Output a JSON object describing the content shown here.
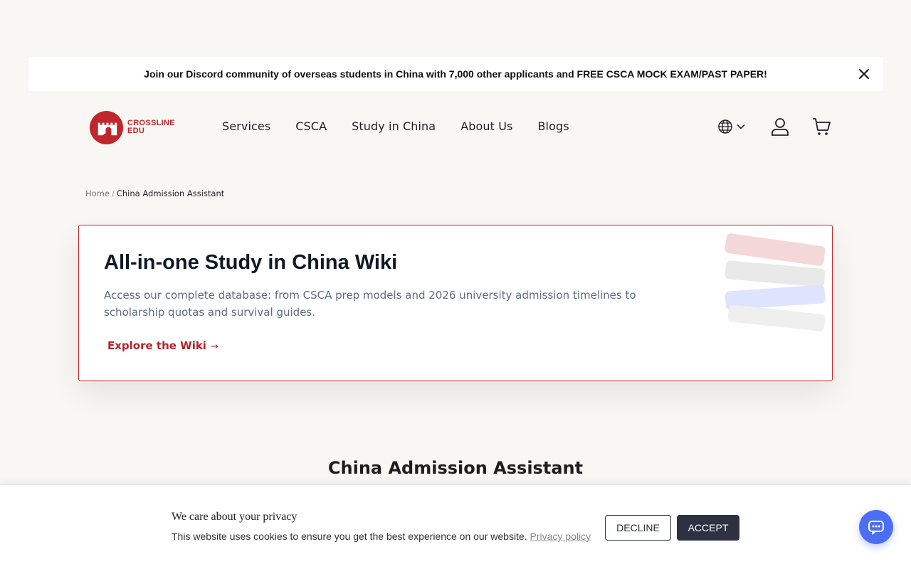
{
  "announcement": {
    "text": "Join our Discord community of overseas students in China with 7,000 other applicants and FREE CSCA MOCK EXAM/PAST PAPER!"
  },
  "brand": {
    "line1": "CROSSLINE",
    "line2": "EDU",
    "color": "#c0272d"
  },
  "nav": {
    "items": [
      {
        "label": "Services"
      },
      {
        "label": "CSCA"
      },
      {
        "label": "Study in China"
      },
      {
        "label": "About Us"
      },
      {
        "label": "Blogs"
      }
    ]
  },
  "header_icons": [
    "globe-icon",
    "chevron-down-icon",
    "account-icon",
    "cart-icon"
  ],
  "breadcrumb": {
    "home": "Home",
    "separator": "/",
    "current": "China Admission Assistant"
  },
  "promo": {
    "title": "All-in-one Study in China Wiki",
    "description": "Access our complete database: from CSCA prep models and 2026 university admission timelines to scholarship quotas and survival guides.",
    "link_label": "Explore the Wiki",
    "link_arrow": "→",
    "accent": "#b3232a"
  },
  "section": {
    "title": "China Admission Assistant"
  },
  "cookie": {
    "title": "We care about your privacy",
    "text": "This website uses cookies to ensure you get the best experience on our website.",
    "policy_link": "Privacy policy",
    "decline_label": "DECLINE",
    "accept_label": "ACCEPT",
    "button_color": "#2d3141"
  },
  "chat": {
    "icon": "chat-icon",
    "color": "#4c6ef5"
  }
}
